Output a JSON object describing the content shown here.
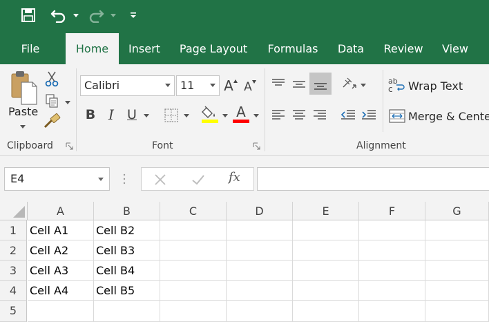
{
  "qat": {
    "save_icon": "save-icon",
    "undo_icon": "undo-icon",
    "redo_icon": "redo-icon",
    "customize_icon": "customize-qat-icon"
  },
  "tabs": [
    {
      "label": "File"
    },
    {
      "label": "Home",
      "active": true
    },
    {
      "label": "Insert"
    },
    {
      "label": "Page Layout"
    },
    {
      "label": "Formulas"
    },
    {
      "label": "Data"
    },
    {
      "label": "Review"
    },
    {
      "label": "View"
    }
  ],
  "ribbon": {
    "clipboard": {
      "label": "Clipboard",
      "paste_label": "Paste"
    },
    "font": {
      "label": "Font",
      "font_name": "Calibri",
      "font_size": "11",
      "grow_label": "A",
      "shrink_label": "A",
      "bold_label": "B",
      "italic_label": "I",
      "underline_label": "U",
      "font_color_label": "A",
      "highlight_color": "#ffff00",
      "font_color": "#ff0000"
    },
    "alignment": {
      "label": "Alignment",
      "wrap_text_label": "Wrap Text",
      "merge_label": "Merge & Center",
      "ab_label": "ab",
      "c_label": "c"
    }
  },
  "formula_bar": {
    "name_box": "E4",
    "fx_label": "fx",
    "formula": ""
  },
  "grid": {
    "columns": [
      "A",
      "B",
      "C",
      "D",
      "E",
      "F",
      "G"
    ],
    "rows": [
      "1",
      "2",
      "3",
      "4",
      "5"
    ],
    "cells": [
      [
        "Cell A1",
        "Cell B2"
      ],
      [
        "Cell A2",
        "Cell B3"
      ],
      [
        "Cell A3",
        "Cell B4"
      ],
      [
        "Cell A4",
        "Cell B5"
      ],
      [
        "",
        ""
      ]
    ]
  },
  "colors": {
    "brand_green": "#217346",
    "ribbon_bg": "#f3f3f3"
  }
}
